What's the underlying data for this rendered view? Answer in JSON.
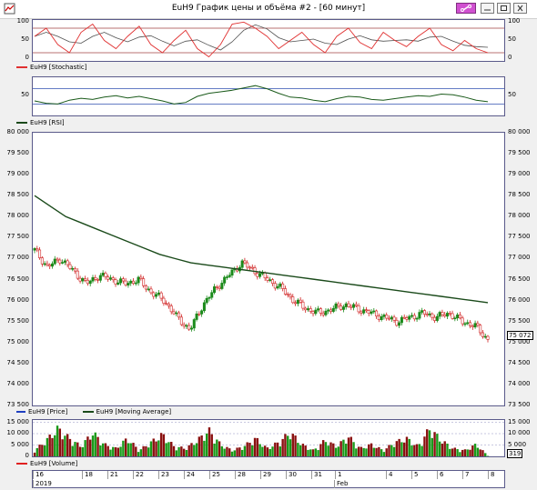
{
  "window": {
    "title": "EuH9 График цены и объёма #2 - [60 минут]"
  },
  "stochastic": {
    "legend": "EuH9 [Stochastic]",
    "levels_left": [
      "100",
      "50",
      "0"
    ],
    "levels_right": [
      "100",
      "50",
      "0"
    ],
    "color_k": "#e03030",
    "color_d": "#505050"
  },
  "rsi": {
    "legend": "EuH9 [RSI]",
    "level_left": "50",
    "level_right": "50",
    "color": "#1a5a1a"
  },
  "price": {
    "legend_price": "EuH9 [Price]",
    "legend_ma": "EuH9 [Moving Average]",
    "axis_left": [
      "80 000",
      "79 500",
      "79 000",
      "78 500",
      "78 000",
      "77 500",
      "77 000",
      "76 500",
      "76 000",
      "75 500",
      "75 000",
      "74 500",
      "74 000",
      "73 500"
    ],
    "axis_right": [
      "80 000",
      "79 500",
      "79 000",
      "78 500",
      "78 000",
      "77 500",
      "77 000",
      "76 500",
      "76 000",
      "75 500",
      "75 000",
      "74 500",
      "74 000",
      "73 500"
    ],
    "last_price": "75 072",
    "ma_color": "#1a4a1a",
    "up_color": "#1a8a1a",
    "down_color": "#d02020"
  },
  "volume": {
    "legend": "EuH9 [Volume]",
    "axis_left": [
      "15 000",
      "10 000",
      "5 000",
      "0"
    ],
    "axis_right": [
      "15 000",
      "10 000",
      "5 000",
      "0"
    ],
    "last_volume": "319",
    "up_color": "#1a9a1a",
    "down_color": "#8a1010"
  },
  "dates": {
    "days": [
      "16",
      "18",
      "21",
      "22",
      "23",
      "24",
      "25",
      "28",
      "29",
      "30",
      "31",
      "1",
      "4",
      "5",
      "6",
      "7",
      "8"
    ],
    "months": [
      "2019",
      "Feb"
    ]
  },
  "chart_data": [
    {
      "type": "line",
      "title": "",
      "series": [
        {
          "name": "EuH9 [Stochastic]",
          "values": [
            60,
            80,
            40,
            20,
            70,
            90,
            50,
            30,
            60,
            85,
            40,
            20,
            50,
            75,
            30,
            10,
            40,
            90,
            95,
            80,
            60,
            30,
            50,
            70,
            40,
            20,
            60,
            80,
            45,
            30,
            70,
            50,
            35,
            60,
            80,
            40,
            25,
            50,
            30,
            20
          ]
        }
      ],
      "ylim": [
        0,
        100
      ]
    },
    {
      "type": "line",
      "title": "",
      "series": [
        {
          "name": "EuH9 [RSI]",
          "values": [
            38,
            32,
            30,
            40,
            45,
            42,
            48,
            52,
            46,
            50,
            44,
            38,
            30,
            34,
            50,
            58,
            62,
            66,
            72,
            78,
            70,
            58,
            48,
            46,
            40,
            36,
            44,
            50,
            48,
            42,
            40,
            44,
            48,
            52,
            50,
            56,
            54,
            48,
            40,
            36
          ]
        }
      ],
      "ylim": [
        0,
        100
      ]
    },
    {
      "type": "line",
      "title": "",
      "series": [
        {
          "name": "EuH9 [Price]",
          "values": [
            77200,
            76800,
            77000,
            76700,
            76400,
            76600,
            76500,
            76400,
            76500,
            76200,
            76000,
            75600,
            75300,
            75900,
            76300,
            76600,
            76900,
            76700,
            76500,
            76300,
            76000,
            75800,
            75700,
            75800,
            75900,
            75800,
            75700,
            75600,
            75500,
            75600,
            75700,
            75600,
            75700,
            75500,
            75400,
            75072
          ]
        },
        {
          "name": "EuH9 [Moving Average]",
          "values": [
            78500,
            78250,
            78000,
            77850,
            77700,
            77550,
            77400,
            77250,
            77100,
            77000,
            76900,
            76850,
            76800,
            76750,
            76700,
            76650,
            76600,
            76550,
            76500,
            76450,
            76400,
            76350,
            76300,
            76250,
            76200,
            76150,
            76100,
            76050,
            76000,
            75950
          ]
        }
      ],
      "ylim": [
        73500,
        80000
      ]
    },
    {
      "type": "bar",
      "title": "",
      "series": [
        {
          "name": "EuH9 [Volume]",
          "values": [
            3000,
            8000,
            14000,
            9000,
            5000,
            12000,
            6000,
            4000,
            9000,
            3000,
            7000,
            11000,
            5000,
            4000,
            8000,
            13000,
            6000,
            3000,
            5000,
            9000,
            4000,
            7000,
            12000,
            6000,
            3000,
            8000,
            5000,
            10000,
            4000,
            6000,
            3000,
            7000,
            9000,
            5000,
            14000,
            8000,
            4000,
            3000,
            6000,
            319
          ]
        }
      ],
      "ylim": [
        0,
        16000
      ]
    }
  ]
}
